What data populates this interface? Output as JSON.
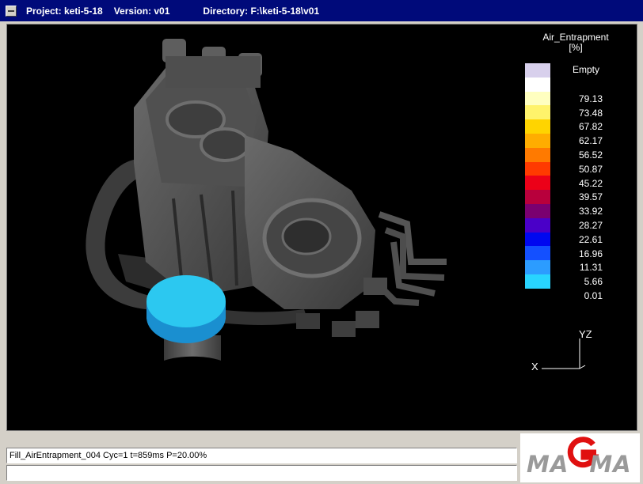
{
  "window": {
    "title_project": "Project: keti-5-18",
    "title_version": "Version: v01",
    "title_directory": "Directory: F:\\keti-5-18\\v01"
  },
  "legend": {
    "title_line1": "Air_Entrapment",
    "title_line2": "[%]",
    "empty_label": "Empty",
    "items": [
      {
        "label": "79.13",
        "color": "#ffffff"
      },
      {
        "label": "73.48",
        "color": "#ffffc0"
      },
      {
        "label": "67.82",
        "color": "#fff36b"
      },
      {
        "label": "62.17",
        "color": "#ffd400"
      },
      {
        "label": "56.52",
        "color": "#ffad00"
      },
      {
        "label": "50.87",
        "color": "#ff7a00"
      },
      {
        "label": "45.22",
        "color": "#ff3a00"
      },
      {
        "label": "39.57",
        "color": "#ec0018"
      },
      {
        "label": "33.92",
        "color": "#b8003c"
      },
      {
        "label": "28.27",
        "color": "#7a0070"
      },
      {
        "label": "22.61",
        "color": "#4a00c8"
      },
      {
        "label": "16.96",
        "color": "#0008f0"
      },
      {
        "label": "11.31",
        "color": "#1450ff"
      },
      {
        "label": "5.66",
        "color": "#2c9cff"
      },
      {
        "label": "0.01",
        "color": "#28d4ff"
      }
    ],
    "empty_color": "#d8d0ec"
  },
  "axes": {
    "x_label": "X",
    "yz_label": "YZ"
  },
  "status": {
    "line1": "Fill_AirEntrapment_004 Cyc=1 t=859ms P=20.00%",
    "line2": ""
  },
  "logo": {
    "text_left": "MA",
    "text_right": "MA",
    "accent_color": "#e01010"
  }
}
